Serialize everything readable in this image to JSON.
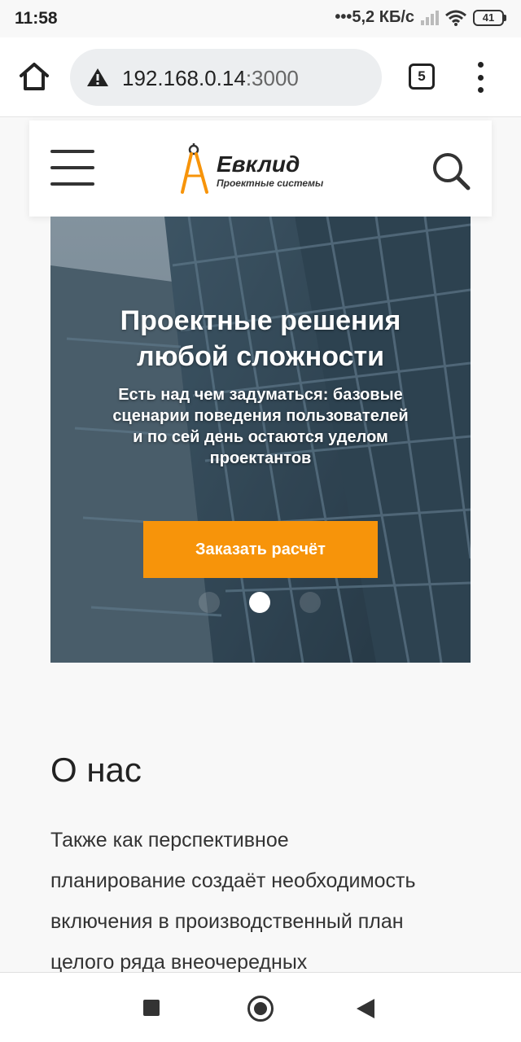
{
  "status_bar": {
    "time": "11:58",
    "speed": "5,2 КБ/с",
    "battery": "41"
  },
  "browser": {
    "url_host": "192.168.0.14",
    "url_port": ":3000",
    "tab_count": "5",
    "icons": [
      "home-icon",
      "warning-icon",
      "tabs-icon",
      "menu-dots-icon"
    ]
  },
  "header": {
    "logo_name": "Евклид",
    "logo_tagline": "Проектные системы",
    "icons": [
      "hamburger-icon",
      "compass-logo-icon",
      "search-icon"
    ]
  },
  "hero": {
    "title_line1": "Проектные решения",
    "title_line2": "любой сложности",
    "text_line1": "Есть над чем задуматься: базовые",
    "text_line2": "сценарии поведения пользователей",
    "text_line3": "и по сей день остаются уделом",
    "text_line4": "проектантов",
    "cta_label": "Заказать расчёт",
    "slide_count": 3,
    "active_slide": 2
  },
  "about": {
    "title": "О нас",
    "line1": "Также как перспективное",
    "line2": "планирование создаёт необходимость",
    "line3": "включения в производственный план",
    "line4": "целого ряда внеочередных"
  },
  "colors": {
    "accent": "#f7940a",
    "hero_overlay": "#3d5566"
  },
  "nav_bar": {
    "icons": [
      "recents-icon",
      "home-circle-icon",
      "back-icon"
    ]
  }
}
